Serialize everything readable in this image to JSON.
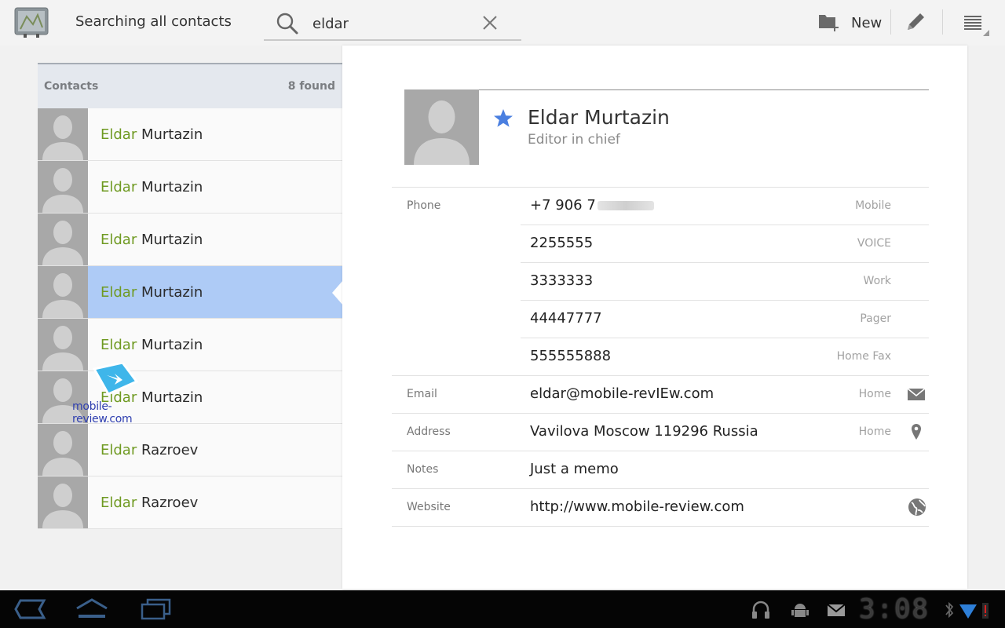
{
  "app": {
    "title": "Searching all contacts"
  },
  "search": {
    "value": "eldar"
  },
  "actionbar": {
    "new_label": "New"
  },
  "list": {
    "header_label": "Contacts",
    "found_label": "8 found",
    "items": [
      {
        "highlight": "Eldar",
        "rest": " Murtazin"
      },
      {
        "highlight": "Eldar",
        "rest": " Murtazin"
      },
      {
        "highlight": "Eldar",
        "rest": " Murtazin"
      },
      {
        "highlight": "Eldar",
        "rest": " Murtazin"
      },
      {
        "highlight": "Eldar",
        "rest": " Murtazin"
      },
      {
        "highlight": "Eldar",
        "rest": " Murtazin"
      },
      {
        "highlight": "Eldar",
        "rest": " Razroev"
      },
      {
        "highlight": "Eldar",
        "rest": " Razroev"
      }
    ],
    "selected_index": 3
  },
  "detail": {
    "name": "Eldar Murtazin",
    "title": "Editor in chief",
    "starred": true,
    "phone_label": "Phone",
    "phones": [
      {
        "value": "+7 906 7",
        "type": "Mobile"
      },
      {
        "value": "2255555",
        "type": "VOICE"
      },
      {
        "value": "3333333",
        "type": "Work"
      },
      {
        "value": "44447777",
        "type": "Pager"
      },
      {
        "value": "555555888",
        "type": "Home Fax"
      }
    ],
    "email": {
      "label": "Email",
      "value": "eldar@mobile-revIEw.com",
      "type": "Home"
    },
    "address": {
      "label": "Address",
      "value": "Vavilova Moscow 119296 Russia",
      "type": "Home"
    },
    "notes": {
      "label": "Notes",
      "value": "Just a memo"
    },
    "website": {
      "label": "Website",
      "value": "http://www.mobile-review.com"
    }
  },
  "watermark": {
    "text": "mobile-review.com"
  },
  "system": {
    "clock": "3:08"
  },
  "colors": {
    "accent_green": "#6f9a22",
    "selected_row": "#aecbf6",
    "star_blue": "#4a7fe0"
  }
}
